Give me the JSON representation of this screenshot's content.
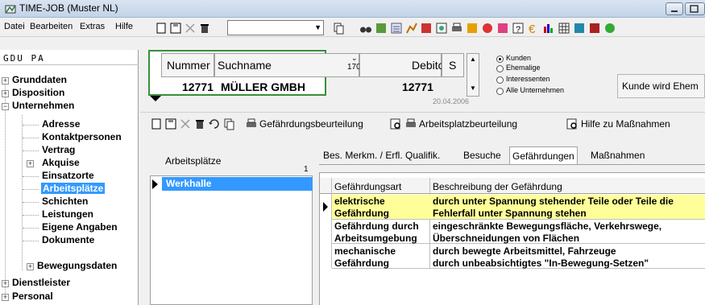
{
  "window": {
    "title": "TIME-JOB  (Muster NL)"
  },
  "menu": {
    "items": [
      "Datei",
      "Bearbeiten",
      "Extras",
      "Hilfe"
    ]
  },
  "left": {
    "header": "GDU PA",
    "tree": [
      {
        "label": "Grunddaten"
      },
      {
        "label": "Disposition"
      },
      {
        "label": "Unternehmen"
      },
      {
        "label": "Adresse"
      },
      {
        "label": "Kontaktpersonen"
      },
      {
        "label": "Vertrag"
      },
      {
        "label": "Akquise"
      },
      {
        "label": "Einsatzorte"
      },
      {
        "label": "Arbeitsplätze"
      },
      {
        "label": "Schichten"
      },
      {
        "label": "Leistungen"
      },
      {
        "label": "Eigene Angaben"
      },
      {
        "label": "Dokumente"
      },
      {
        "label": "Bewegungsdaten"
      },
      {
        "label": "Dienstleister"
      },
      {
        "label": "Personal"
      }
    ]
  },
  "customer": {
    "col_nummer": "Nummer",
    "col_suchname": "Suchname",
    "col_count": "170",
    "col_debitor": "Debitor",
    "col_s": "S",
    "nummer": "12771",
    "suchname": "MÜLLER GMBH",
    "debitor": "12771",
    "date": "20.04.2006"
  },
  "filter": {
    "options": [
      "Kunden",
      "Ehemalige",
      "Interessenten",
      "Alle Unternehmen"
    ],
    "selected": "Kunden"
  },
  "status_button": "Kunde wird Ehem",
  "toolbar2": {
    "btn1": "Gefährdungsbeurteilung",
    "btn2": "Arbeitsplatzbeurteilung",
    "btn3": "Hilfe zu Maßnahmen"
  },
  "workplaces": {
    "header": "Arbeitsplätze",
    "count": "1",
    "items": [
      "Werkhalle"
    ]
  },
  "tabs": [
    "Bes. Merkm. / Erfl. Qualifik.",
    "Besuche",
    "Gefährdungen",
    "Maßnahmen"
  ],
  "active_tab": "Gefährdungen",
  "grid": {
    "columns": [
      "Gefährdungsart",
      "Beschreibung der Gefährdung"
    ],
    "rows": [
      {
        "art": [
          "elektrische",
          "Gefährdung"
        ],
        "desc": [
          "durch unter Spannung stehender Teile oder Teile die",
          "Fehlerfall unter Spannung stehen"
        ]
      },
      {
        "art": [
          "Gefährdung durch",
          "Arbeitsumgebung"
        ],
        "desc": [
          "eingeschränkte Bewegungsfläche, Verkehrswege,",
          "Überschneidungen von Flächen"
        ]
      },
      {
        "art": [
          "mechanische",
          "Gefährdung"
        ],
        "desc": [
          "durch bewegte Arbeitsmittel, Fahrzeuge",
          "durch unbeabsichtigtes \"In-Bewegung-Setzen\""
        ]
      }
    ]
  },
  "colors": {
    "selection": "#3399ff",
    "row_highlight": "#ffff99",
    "panel_border": "#3a8f3a"
  }
}
